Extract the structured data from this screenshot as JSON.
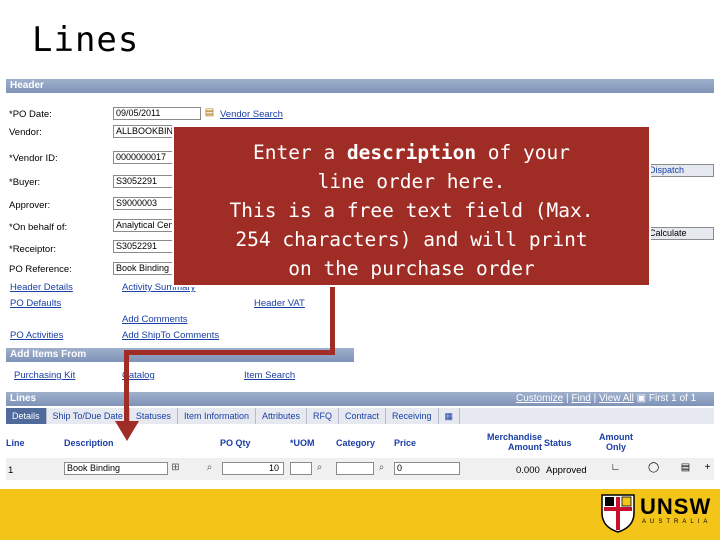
{
  "slide": {
    "title": "Lines"
  },
  "header": {
    "bar_label": "Header",
    "po_date_label": "*PO Date:",
    "po_date_value": "09/05/2011",
    "vendor_search": "Vendor Search",
    "vendor_label": "Vendor:",
    "vendor_value": "ALLBOOKBIN",
    "vendor_id_label": "*Vendor ID:",
    "vendor_id_value": "0000000017",
    "buyer_label": "*Buyer:",
    "buyer_value": "S3052291",
    "approver_label": "Approver:",
    "approver_value": "S9000003",
    "on_behalf_label": "*On behalf of:",
    "on_behalf_value": "Analytical Cen",
    "receiptor_label": "*Receiptor:",
    "receiptor_value": "S3052291",
    "po_reference_label": "PO Reference:",
    "po_reference_value": "Book Binding",
    "dispatch_button": "Dispatch",
    "schedule_button": "Calculate",
    "links": {
      "header_details": "Header Details",
      "activity_summary": "Activity Summary",
      "po_defaults": "PO Defaults",
      "header_vat": "Header VAT",
      "add_comments": "Add Comments",
      "po_activities": "PO Activities",
      "add_ship_to_comments": "Add ShipTo Comments"
    }
  },
  "add_items": {
    "bar_label": "Add Items From",
    "purchasing_kit": "Purchasing Kit",
    "catalog": "Catalog",
    "item_search": "Item Search"
  },
  "lines": {
    "bar_label": "Lines",
    "toolbar": {
      "customize": "Customize",
      "find": "Find",
      "view_all": "View All",
      "first": "First",
      "page_info": "1 of 1"
    },
    "tabs": [
      "Details",
      "Ship To/Due Date",
      "Statuses",
      "Item Information",
      "Attributes",
      "RFQ",
      "Contract",
      "Receiving"
    ],
    "columns": {
      "line": "Line",
      "description": "Description",
      "po_qty": "PO Qty",
      "uom": "*UOM",
      "category": "Category",
      "price": "Price",
      "merchandise_amount": "Merchandise Amount",
      "status": "Status",
      "amount_only": "Amount Only"
    },
    "row": {
      "line": "1",
      "description": "Book Binding",
      "po_qty": "10",
      "uom": "",
      "category": "",
      "price": "0",
      "merchandise_amount": "0.000",
      "status": "Approved"
    }
  },
  "callout": {
    "line1_pre": "Enter a ",
    "line1_bold": "description",
    "line1_post": " of your",
    "line2": "line order here.",
    "line3": "This is a free text field (Max.",
    "line4": "254 characters) and will print",
    "line5": "on the purchase order"
  },
  "footer": {
    "logo_text": "UNSW",
    "logo_sub": "AUSTRALIA"
  },
  "colors": {
    "callout": "#a02c26",
    "footer": "#f3c518",
    "bar": "#7f93b8",
    "link": "#1a3fa5"
  }
}
